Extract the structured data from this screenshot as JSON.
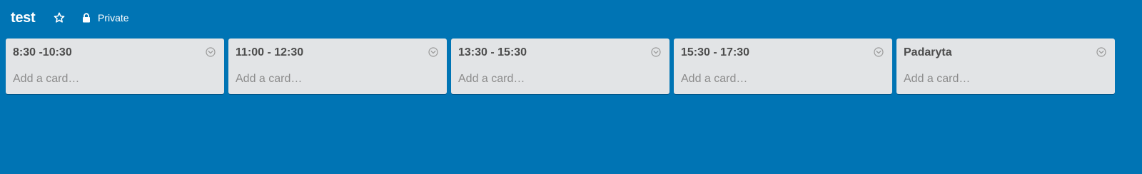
{
  "board": {
    "title": "test",
    "visibility": "Private",
    "star_icon": "star-outline-icon",
    "lock_icon": "lock-icon",
    "background_color": "#0074b4"
  },
  "lists": [
    {
      "title": "8:30 -10:30",
      "add_card_label": "Add a card…"
    },
    {
      "title": "11:00 - 12:30",
      "add_card_label": "Add a card…"
    },
    {
      "title": "13:30 - 15:30",
      "add_card_label": "Add a card…"
    },
    {
      "title": "15:30 - 17:30",
      "add_card_label": "Add a card…"
    },
    {
      "title": "Padaryta",
      "add_card_label": "Add a card…"
    }
  ]
}
